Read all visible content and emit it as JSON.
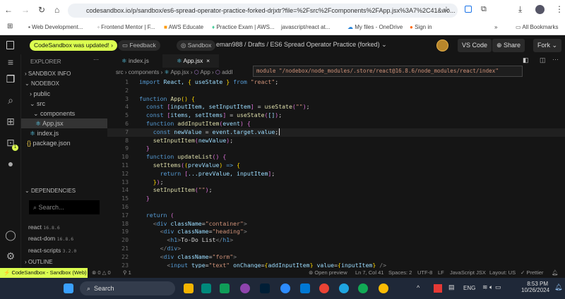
{
  "browser": {
    "url": "codesandbox.io/p/sandbox/es6-spread-operator-practice-forked-drjxtr?file=%2Fsrc%2Fcomponents%2FApp.jsx%3A7%2C41&wo...",
    "bookmarks": [
      "Web Development...",
      "Frontend Mentor | F...",
      "AWS Educate",
      "Practice Exam | AWS...",
      "javascript/react at...",
      "My files - OneDrive",
      "Sign in"
    ],
    "all_bookmarks": "All Bookmarks"
  },
  "header": {
    "update_badge": "CodeSandbox was updated!",
    "feedback": "Feedback",
    "sandbox": "Sandbox",
    "path": "eman988 / Drafts / ES6 Spread Operator Practice (forked)",
    "vscode": "VS Code",
    "share": "Share",
    "fork": "Fork",
    "accent": "#dcff50"
  },
  "sidebar": {
    "explorer": "EXPLORER",
    "sandbox_info": "SANDBOX INFO",
    "nodebox": "NODEBOX",
    "tree": [
      "public",
      "src",
      "components",
      "App.jsx",
      "index.js",
      "package.json"
    ],
    "dependencies": "DEPENDENCIES",
    "search_placeholder": "Search...",
    "deps": [
      {
        "name": "react",
        "version": "16.8.6"
      },
      {
        "name": "react-dom",
        "version": "16.8.6"
      },
      {
        "name": "react-scripts",
        "version": "3.2.0"
      }
    ],
    "outline": "OUTLINE",
    "terminal_badge": "1"
  },
  "tabs": [
    {
      "label": "index.js"
    },
    {
      "label": "App.jsx",
      "close": "×"
    }
  ],
  "breadcrumb": [
    "src",
    "components",
    "App.jsx",
    "App",
    "addI"
  ],
  "hover": "module \"/nodebox/node_modules/.store/react@16.8.6/node_modules/react/index\"",
  "code": [
    [
      [
        "import",
        "kw"
      ],
      [
        " React, ",
        "vr"
      ],
      [
        "{",
        "b1"
      ],
      [
        " useState ",
        "vr"
      ],
      [
        "}",
        "b1"
      ],
      [
        " from ",
        "kw"
      ],
      [
        "\"react\"",
        "st"
      ],
      [
        ";",
        "pl"
      ]
    ],
    [],
    [
      [
        "function ",
        "kw"
      ],
      [
        "App",
        "fn"
      ],
      [
        "() ",
        "b1"
      ],
      [
        "{",
        "b1"
      ]
    ],
    [
      [
        "  const ",
        "kw"
      ],
      [
        "[",
        "b2"
      ],
      [
        "inputItem, setInputItem",
        "vr"
      ],
      [
        "]",
        "b2"
      ],
      [
        " = ",
        "pl"
      ],
      [
        "useState",
        "fn"
      ],
      [
        "(",
        "b2"
      ],
      [
        "\"\"",
        "st"
      ],
      [
        ")",
        "b2"
      ],
      [
        ";",
        "pl"
      ]
    ],
    [
      [
        "  const ",
        "kw"
      ],
      [
        "[",
        "b2"
      ],
      [
        "items, setItems",
        "vr"
      ],
      [
        "]",
        "b2"
      ],
      [
        " = ",
        "pl"
      ],
      [
        "useState",
        "fn"
      ],
      [
        "(",
        "b2"
      ],
      [
        "[]",
        "vr"
      ],
      [
        ")",
        "b2"
      ],
      [
        ";",
        "pl"
      ]
    ],
    [
      [
        "  function ",
        "kw"
      ],
      [
        "addInputItem",
        "fn"
      ],
      [
        "(",
        "b2"
      ],
      [
        "event",
        "vr"
      ],
      [
        ") ",
        "b2"
      ],
      [
        "{",
        "b2"
      ]
    ],
    [
      [
        "    const ",
        "kw"
      ],
      [
        "newValue",
        "vr"
      ],
      [
        " = ",
        "pl"
      ],
      [
        "event.target.value",
        "vr"
      ],
      [
        ";",
        "pl"
      ]
    ],
    [
      [
        "    setInputItem",
        "fn"
      ],
      [
        "(",
        "b2"
      ],
      [
        "newValue",
        "vr"
      ],
      [
        ")",
        "b2"
      ],
      [
        ";",
        "pl"
      ]
    ],
    [
      [
        "  }",
        "b2"
      ]
    ],
    [
      [
        "  function ",
        "kw"
      ],
      [
        "updateList",
        "fn"
      ],
      [
        "() ",
        "b2"
      ],
      [
        "{",
        "b2"
      ]
    ],
    [
      [
        "    setItems",
        "fn"
      ],
      [
        "(",
        "b2"
      ],
      [
        "(",
        "b1"
      ],
      [
        "prevValue",
        "vr"
      ],
      [
        ")",
        "b1"
      ],
      [
        " => ",
        "kw"
      ],
      [
        "{",
        "b1"
      ]
    ],
    [
      [
        "      return ",
        "kw"
      ],
      [
        "[",
        "b2"
      ],
      [
        "...prevValue, inputItem",
        "vr"
      ],
      [
        "]",
        "b2"
      ],
      [
        ";",
        "pl"
      ]
    ],
    [
      [
        "    }",
        "b1"
      ],
      [
        ")",
        "b2"
      ],
      [
        ";",
        "pl"
      ]
    ],
    [
      [
        "    setInputItem",
        "fn"
      ],
      [
        "(",
        "b2"
      ],
      [
        "\"\"",
        "st"
      ],
      [
        ")",
        "b2"
      ],
      [
        ";",
        "pl"
      ]
    ],
    [
      [
        "  }",
        "b2"
      ]
    ],
    [],
    [
      [
        "  return ",
        "kw"
      ],
      [
        "(",
        "b2"
      ]
    ],
    [
      [
        "    <",
        "tg"
      ],
      [
        "div ",
        "tn"
      ],
      [
        "className",
        "at"
      ],
      [
        "=",
        "pl"
      ],
      [
        "\"container\"",
        "st"
      ],
      [
        ">",
        "tg"
      ]
    ],
    [
      [
        "      <",
        "tg"
      ],
      [
        "div ",
        "tn"
      ],
      [
        "className",
        "at"
      ],
      [
        "=",
        "pl"
      ],
      [
        "\"heading\"",
        "st"
      ],
      [
        ">",
        "tg"
      ]
    ],
    [
      [
        "        <",
        "tg"
      ],
      [
        "h1",
        "tn"
      ],
      [
        ">",
        "tg"
      ],
      [
        "To-Do List",
        "pl"
      ],
      [
        "</",
        "tg"
      ],
      [
        "h1",
        "tn"
      ],
      [
        ">",
        "tg"
      ]
    ],
    [
      [
        "      </",
        "tg"
      ],
      [
        "div",
        "tn"
      ],
      [
        ">",
        "tg"
      ]
    ],
    [
      [
        "      <",
        "tg"
      ],
      [
        "div ",
        "tn"
      ],
      [
        "className",
        "at"
      ],
      [
        "=",
        "pl"
      ],
      [
        "\"form\"",
        "st"
      ],
      [
        ">",
        "tg"
      ]
    ],
    [
      [
        "        <",
        "tg"
      ],
      [
        "input ",
        "tn"
      ],
      [
        "type",
        "at"
      ],
      [
        "=",
        "pl"
      ],
      [
        "\"text\"",
        "st"
      ],
      [
        " onChange",
        "at"
      ],
      [
        "=",
        "pl"
      ],
      [
        "{",
        "b1"
      ],
      [
        "addInputItem",
        "vr"
      ],
      [
        "}",
        "b1"
      ],
      [
        " value",
        "at"
      ],
      [
        "=",
        "pl"
      ],
      [
        "{",
        "b1"
      ],
      [
        "inputItem",
        "vr"
      ],
      [
        "}",
        "b1"
      ],
      [
        " />",
        "tg"
      ]
    ]
  ],
  "status": {
    "left": "CodeSandbox - Sandbox (Web)",
    "problems": "⊗ 0 △ 0",
    "ports": "⚲ 1",
    "open_preview": "Open preview",
    "position": "Ln 7, Col 41",
    "spaces": "Spaces: 2",
    "encoding": "UTF-8",
    "eol": "LF",
    "language": "JavaScript JSX",
    "layout": "Layout: US",
    "prettier": "Prettier"
  },
  "taskbar": {
    "search": "Search",
    "lang": "ENG",
    "time": "8:53 PM",
    "date": "10/26/2024"
  }
}
